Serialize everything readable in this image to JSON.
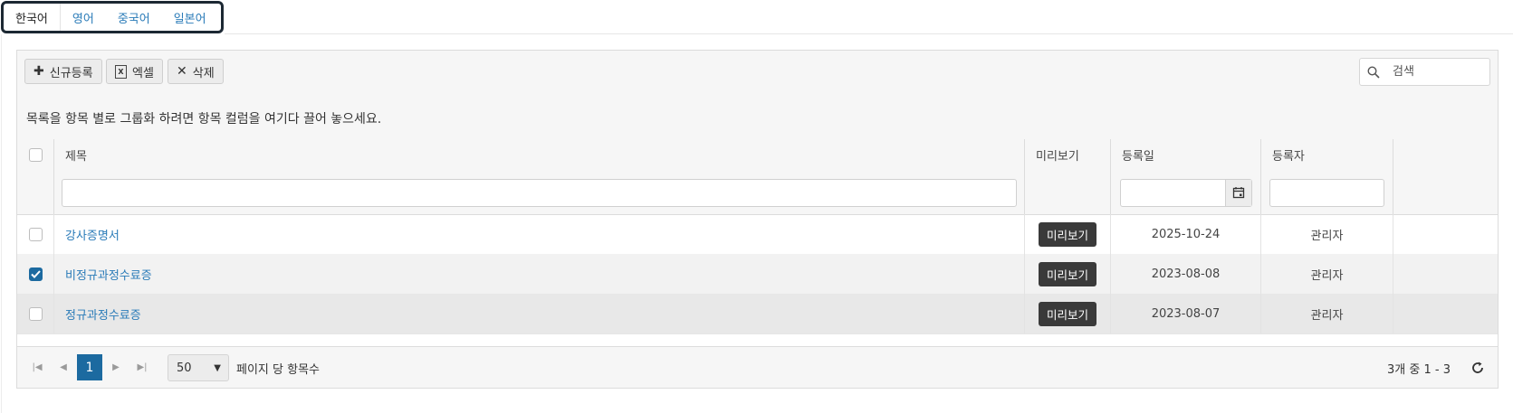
{
  "lang_tabs": [
    "한국어",
    "영어",
    "중국어",
    "일본어"
  ],
  "toolbar": {
    "new_label": "신규등록",
    "excel_label": "엑셀",
    "excel_icon": "X",
    "delete_label": "삭제",
    "search_placeholder": "검색"
  },
  "group_hint": "목록을 항목 별로 그룹화 하려면 항목 컬럼을 여기다 끌어 놓으세요.",
  "columns": {
    "title": "제목",
    "preview": "미리보기",
    "date": "등록일",
    "author": "등록자"
  },
  "rows": [
    {
      "title": "강사증명서",
      "preview": "미리보기",
      "date": "2025-10-24",
      "author": "관리자",
      "checked": false
    },
    {
      "title": "비정규과정수료증",
      "preview": "미리보기",
      "date": "2023-08-08",
      "author": "관리자",
      "checked": true
    },
    {
      "title": "정규과정수료증",
      "preview": "미리보기",
      "date": "2023-08-07",
      "author": "관리자",
      "checked": false
    }
  ],
  "pager": {
    "current_page": "1",
    "page_size": "50",
    "page_size_label": "페이지 당 항목수",
    "info": "3개 중 1 - 3"
  },
  "colors": {
    "accent": "#1c6aa0",
    "link": "#2a7bb8",
    "preview_button": "#3a3a3a"
  }
}
